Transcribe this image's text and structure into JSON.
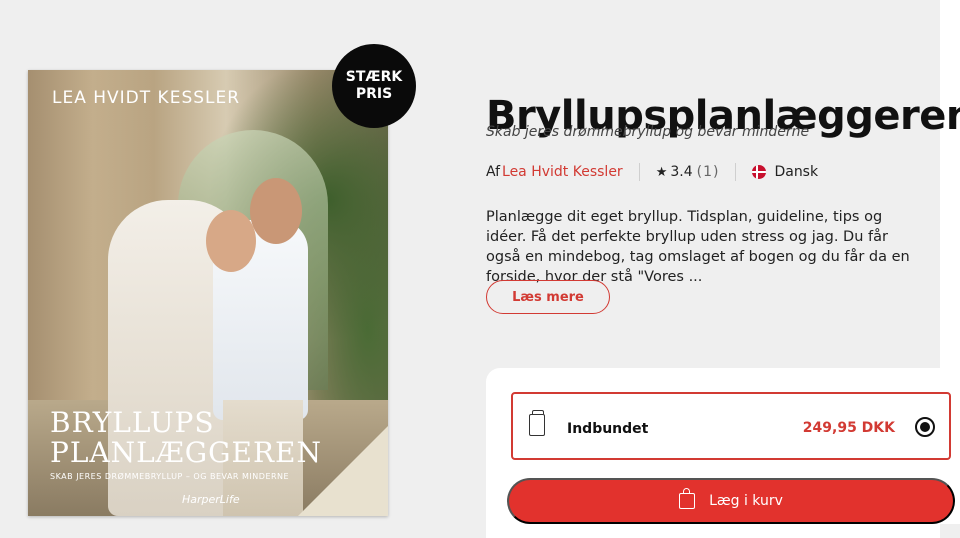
{
  "cover": {
    "author": "LEA HVIDT KESSLER",
    "title_line1": "BRYLLUPS",
    "title_line2": "PLANLÆGGEREN",
    "subtitle": "SKAB JERES DRØMMEBRYLLUP – OG BEVAR MINDERNE",
    "publisher": "HarperLife"
  },
  "badge": {
    "line1": "STÆRK",
    "line2": "PRIS"
  },
  "product": {
    "title": "Bryllupsplanlæggeren",
    "subtitle": "Skab jeres drømmebryllup og bevar minderne",
    "by_label": "Af",
    "author": "Lea Hvidt Kessler",
    "rating": "3.4",
    "rating_count": "(1)",
    "language": "Dansk",
    "description": "Planlægge dit eget bryllup. Tidsplan, guideline, tips og idéer. Få det perfekte bryllup uden stress og jag. Du får også en mindebog, tag omslaget af bogen og du får da en forside, hvor der stå \"Vores ...",
    "read_more": "Læs mere"
  },
  "purchase": {
    "format": "Indbundet",
    "price": "249,95 DKK",
    "selected": true,
    "add_to_cart": "Læg i kurv"
  },
  "colors": {
    "accent": "#d23a33",
    "button": "#e2322d",
    "background": "#efefef"
  },
  "icons": [
    "star-icon",
    "danish-flag-icon",
    "book-icon",
    "radio-selected-icon",
    "shopping-bag-icon"
  ]
}
